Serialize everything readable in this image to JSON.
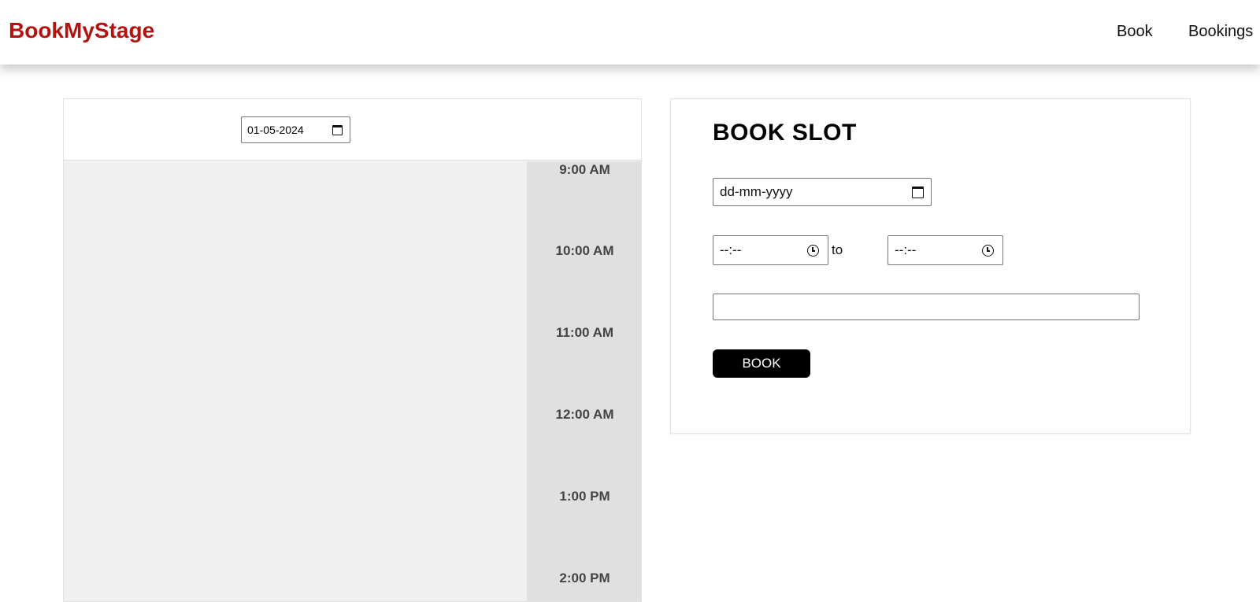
{
  "header": {
    "brand": "BookMyStage",
    "brand_color": "#b3120f",
    "nav": [
      {
        "label": "Book"
      },
      {
        "label": "Bookings"
      }
    ]
  },
  "schedule": {
    "date_value": "01-05-2024",
    "times": [
      "9:00 AM",
      "10:00 AM",
      "11:00 AM",
      "12:00 AM",
      "1:00 PM",
      "2:00 PM"
    ]
  },
  "booking_form": {
    "title": "BOOK SLOT",
    "date_placeholder": "dd-mm-yyyy",
    "start_time_placeholder": "--:--",
    "to_label": "to",
    "end_time_placeholder": "--:--",
    "text_value": "",
    "submit_label": "BOOK"
  },
  "icons": {
    "date": "calendar-icon",
    "time": "clock-icon"
  }
}
